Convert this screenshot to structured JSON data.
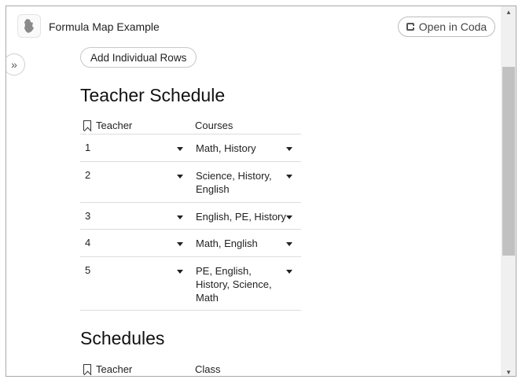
{
  "header": {
    "title": "Formula Map Example",
    "open_label": "Open in Coda"
  },
  "toolbar": {
    "add_rows_label": "Add Individual Rows"
  },
  "section1": {
    "title": "Teacher Schedule",
    "columns": [
      "Teacher",
      "Courses"
    ],
    "rows": [
      {
        "teacher": "1",
        "courses": "Math, History"
      },
      {
        "teacher": "2",
        "courses": "Science, History, English"
      },
      {
        "teacher": "3",
        "courses": "English, PE, History"
      },
      {
        "teacher": "4",
        "courses": "Math, English"
      },
      {
        "teacher": "5",
        "courses": "PE, English, History, Science, Math"
      }
    ]
  },
  "section2": {
    "title": "Schedules",
    "columns": [
      "Teacher",
      "Class"
    ]
  },
  "icons": {
    "doc": "document-logo-icon",
    "coda": "coda-icon",
    "toggle": "double-chevron-right-icon",
    "bookmark": "bookmark-icon",
    "dropdown": "caret-down-icon"
  }
}
